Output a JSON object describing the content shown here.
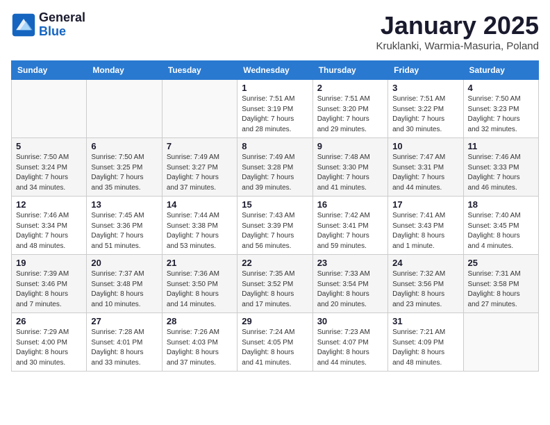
{
  "header": {
    "logo_general": "General",
    "logo_blue": "Blue",
    "month_title": "January 2025",
    "location": "Kruklanki, Warmia-Masuria, Poland"
  },
  "days_of_week": [
    "Sunday",
    "Monday",
    "Tuesday",
    "Wednesday",
    "Thursday",
    "Friday",
    "Saturday"
  ],
  "weeks": [
    [
      {
        "day": "",
        "text": ""
      },
      {
        "day": "",
        "text": ""
      },
      {
        "day": "",
        "text": ""
      },
      {
        "day": "1",
        "text": "Sunrise: 7:51 AM\nSunset: 3:19 PM\nDaylight: 7 hours\nand 28 minutes."
      },
      {
        "day": "2",
        "text": "Sunrise: 7:51 AM\nSunset: 3:20 PM\nDaylight: 7 hours\nand 29 minutes."
      },
      {
        "day": "3",
        "text": "Sunrise: 7:51 AM\nSunset: 3:22 PM\nDaylight: 7 hours\nand 30 minutes."
      },
      {
        "day": "4",
        "text": "Sunrise: 7:50 AM\nSunset: 3:23 PM\nDaylight: 7 hours\nand 32 minutes."
      }
    ],
    [
      {
        "day": "5",
        "text": "Sunrise: 7:50 AM\nSunset: 3:24 PM\nDaylight: 7 hours\nand 34 minutes."
      },
      {
        "day": "6",
        "text": "Sunrise: 7:50 AM\nSunset: 3:25 PM\nDaylight: 7 hours\nand 35 minutes."
      },
      {
        "day": "7",
        "text": "Sunrise: 7:49 AM\nSunset: 3:27 PM\nDaylight: 7 hours\nand 37 minutes."
      },
      {
        "day": "8",
        "text": "Sunrise: 7:49 AM\nSunset: 3:28 PM\nDaylight: 7 hours\nand 39 minutes."
      },
      {
        "day": "9",
        "text": "Sunrise: 7:48 AM\nSunset: 3:30 PM\nDaylight: 7 hours\nand 41 minutes."
      },
      {
        "day": "10",
        "text": "Sunrise: 7:47 AM\nSunset: 3:31 PM\nDaylight: 7 hours\nand 44 minutes."
      },
      {
        "day": "11",
        "text": "Sunrise: 7:46 AM\nSunset: 3:33 PM\nDaylight: 7 hours\nand 46 minutes."
      }
    ],
    [
      {
        "day": "12",
        "text": "Sunrise: 7:46 AM\nSunset: 3:34 PM\nDaylight: 7 hours\nand 48 minutes."
      },
      {
        "day": "13",
        "text": "Sunrise: 7:45 AM\nSunset: 3:36 PM\nDaylight: 7 hours\nand 51 minutes."
      },
      {
        "day": "14",
        "text": "Sunrise: 7:44 AM\nSunset: 3:38 PM\nDaylight: 7 hours\nand 53 minutes."
      },
      {
        "day": "15",
        "text": "Sunrise: 7:43 AM\nSunset: 3:39 PM\nDaylight: 7 hours\nand 56 minutes."
      },
      {
        "day": "16",
        "text": "Sunrise: 7:42 AM\nSunset: 3:41 PM\nDaylight: 7 hours\nand 59 minutes."
      },
      {
        "day": "17",
        "text": "Sunrise: 7:41 AM\nSunset: 3:43 PM\nDaylight: 8 hours\nand 1 minute."
      },
      {
        "day": "18",
        "text": "Sunrise: 7:40 AM\nSunset: 3:45 PM\nDaylight: 8 hours\nand 4 minutes."
      }
    ],
    [
      {
        "day": "19",
        "text": "Sunrise: 7:39 AM\nSunset: 3:46 PM\nDaylight: 8 hours\nand 7 minutes."
      },
      {
        "day": "20",
        "text": "Sunrise: 7:37 AM\nSunset: 3:48 PM\nDaylight: 8 hours\nand 10 minutes."
      },
      {
        "day": "21",
        "text": "Sunrise: 7:36 AM\nSunset: 3:50 PM\nDaylight: 8 hours\nand 14 minutes."
      },
      {
        "day": "22",
        "text": "Sunrise: 7:35 AM\nSunset: 3:52 PM\nDaylight: 8 hours\nand 17 minutes."
      },
      {
        "day": "23",
        "text": "Sunrise: 7:33 AM\nSunset: 3:54 PM\nDaylight: 8 hours\nand 20 minutes."
      },
      {
        "day": "24",
        "text": "Sunrise: 7:32 AM\nSunset: 3:56 PM\nDaylight: 8 hours\nand 23 minutes."
      },
      {
        "day": "25",
        "text": "Sunrise: 7:31 AM\nSunset: 3:58 PM\nDaylight: 8 hours\nand 27 minutes."
      }
    ],
    [
      {
        "day": "26",
        "text": "Sunrise: 7:29 AM\nSunset: 4:00 PM\nDaylight: 8 hours\nand 30 minutes."
      },
      {
        "day": "27",
        "text": "Sunrise: 7:28 AM\nSunset: 4:01 PM\nDaylight: 8 hours\nand 33 minutes."
      },
      {
        "day": "28",
        "text": "Sunrise: 7:26 AM\nSunset: 4:03 PM\nDaylight: 8 hours\nand 37 minutes."
      },
      {
        "day": "29",
        "text": "Sunrise: 7:24 AM\nSunset: 4:05 PM\nDaylight: 8 hours\nand 41 minutes."
      },
      {
        "day": "30",
        "text": "Sunrise: 7:23 AM\nSunset: 4:07 PM\nDaylight: 8 hours\nand 44 minutes."
      },
      {
        "day": "31",
        "text": "Sunrise: 7:21 AM\nSunset: 4:09 PM\nDaylight: 8 hours\nand 48 minutes."
      },
      {
        "day": "",
        "text": ""
      }
    ]
  ]
}
